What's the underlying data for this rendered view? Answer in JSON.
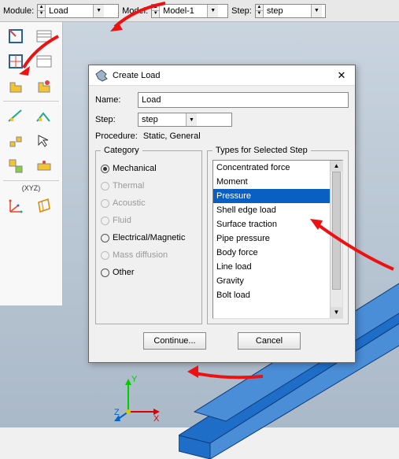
{
  "topbar": {
    "module_label": "Module:",
    "module_value": "Load",
    "model_label": "Model:",
    "model_value": "Model-1",
    "step_label": "Step:",
    "step_value": "step"
  },
  "palette": {
    "xyz_label": "(XYZ)"
  },
  "dialog": {
    "title": "Create Load",
    "name_label": "Name:",
    "name_value": "Load",
    "step_label": "Step:",
    "step_value": "step",
    "procedure_label": "Procedure:",
    "procedure_value": "Static, General",
    "category_legend": "Category",
    "types_legend": "Types for Selected Step",
    "categories": [
      {
        "label": "Mechanical",
        "enabled": true,
        "selected": true
      },
      {
        "label": "Thermal",
        "enabled": false,
        "selected": false
      },
      {
        "label": "Acoustic",
        "enabled": false,
        "selected": false
      },
      {
        "label": "Fluid",
        "enabled": false,
        "selected": false
      },
      {
        "label": "Electrical/Magnetic",
        "enabled": true,
        "selected": false
      },
      {
        "label": "Mass diffusion",
        "enabled": false,
        "selected": false
      },
      {
        "label": "Other",
        "enabled": true,
        "selected": false
      }
    ],
    "types": [
      {
        "label": "Concentrated force",
        "selected": false
      },
      {
        "label": "Moment",
        "selected": false
      },
      {
        "label": "Pressure",
        "selected": true
      },
      {
        "label": "Shell edge load",
        "selected": false
      },
      {
        "label": "Surface traction",
        "selected": false
      },
      {
        "label": "Pipe pressure",
        "selected": false
      },
      {
        "label": "Body force",
        "selected": false
      },
      {
        "label": "Line load",
        "selected": false
      },
      {
        "label": "Gravity",
        "selected": false
      },
      {
        "label": "Bolt load",
        "selected": false
      }
    ],
    "continue_btn": "Continue...",
    "cancel_btn": "Cancel"
  },
  "axis": {
    "x": "X",
    "y": "Y",
    "z": "Z"
  }
}
